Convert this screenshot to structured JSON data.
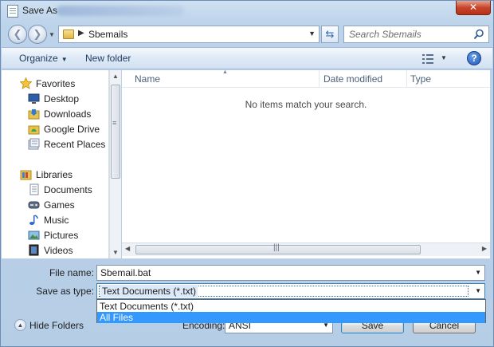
{
  "window": {
    "title": "Save As",
    "close_glyph": "✕"
  },
  "address_bar": {
    "path": "Sbemails",
    "back_glyph": "❮",
    "forward_glyph": "❯"
  },
  "search": {
    "placeholder": "Search Sbemails"
  },
  "toolbar": {
    "organize_label": "Organize",
    "new_folder_label": "New folder",
    "help_glyph": "?"
  },
  "nav_pane": {
    "favorites_label": "Favorites",
    "favorites": [
      {
        "label": "Desktop",
        "icon": "desktop-icon"
      },
      {
        "label": "Downloads",
        "icon": "downloads-icon"
      },
      {
        "label": "Google Drive",
        "icon": "google-drive-icon"
      },
      {
        "label": "Recent Places",
        "icon": "recent-places-icon"
      }
    ],
    "libraries_label": "Libraries",
    "libraries": [
      {
        "label": "Documents",
        "icon": "documents-icon"
      },
      {
        "label": "Games",
        "icon": "games-icon"
      },
      {
        "label": "Music",
        "icon": "music-icon"
      },
      {
        "label": "Pictures",
        "icon": "pictures-icon"
      },
      {
        "label": "Videos",
        "icon": "videos-icon"
      }
    ]
  },
  "file_list": {
    "columns": [
      "Name",
      "Date modified",
      "Type"
    ],
    "empty_message": "No items match your search."
  },
  "form": {
    "file_name_label": "File name:",
    "file_name_value": "Sbemail.bat",
    "save_type_label": "Save as type:",
    "save_type_value": "Text Documents (*.txt)",
    "save_type_options": [
      "Text Documents (*.txt)",
      "All Files"
    ],
    "save_type_highlighted": "All Files",
    "hide_folders_label": "Hide Folders",
    "encoding_label": "Encoding:",
    "encoding_value": "ANSI",
    "save_button": "Save",
    "cancel_button": "Cancel"
  },
  "colors": {
    "highlight": "#3399ff",
    "frame": "#b9d1ea",
    "close_button": "#c7452a"
  }
}
